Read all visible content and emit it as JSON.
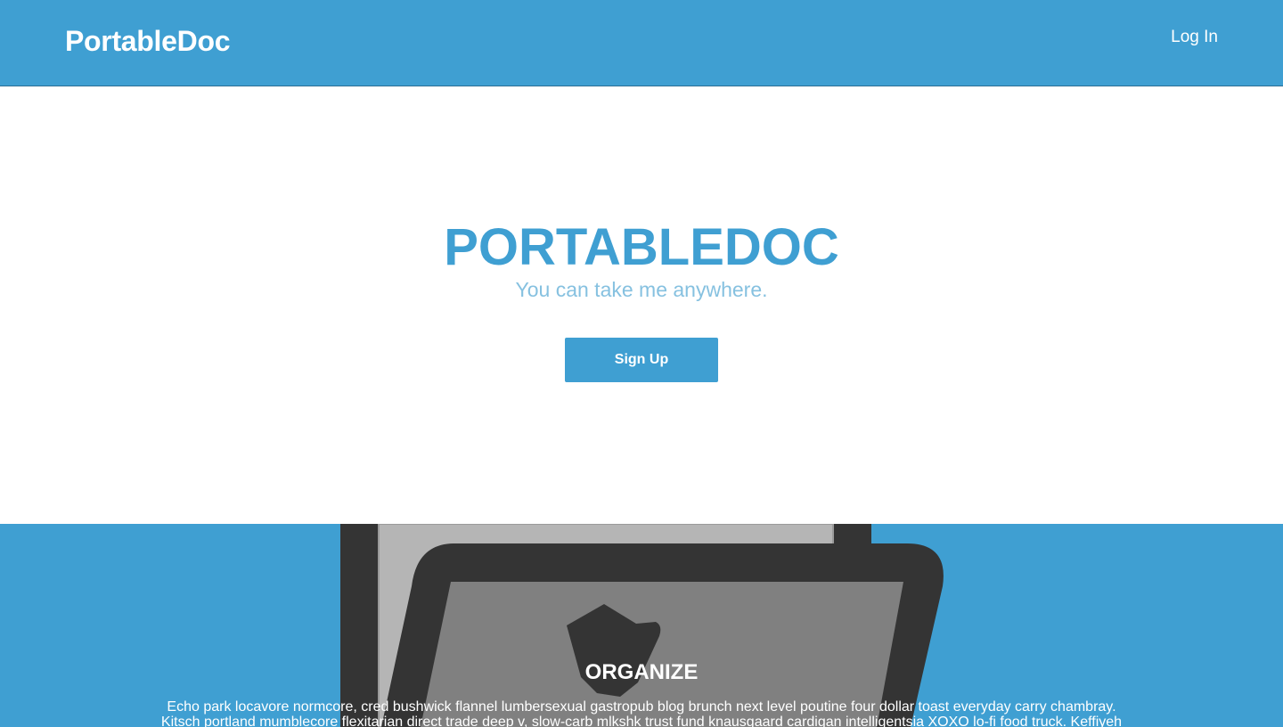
{
  "navbar": {
    "brand": "PortableDoc",
    "login_label": "Log In",
    "background_color": "#3f9fd2"
  },
  "hero": {
    "title": "PORTABLEDOC",
    "subtitle": "You can take me anywhere.",
    "signup_label": "Sign Up",
    "accent_color": "#3f9fd2"
  },
  "feature": {
    "title": "ORGANIZE",
    "body": "Echo park locavore normcore, cred bushwick flannel lumbersexual gastropub blog brunch next level poutine four dollar toast everyday carry chambray. Kitsch portland mumblecore flexitarian direct trade deep v, slow-carb mlkshk trust fund knausgaard cardigan intelligentsia XOXO lo-fi food truck. Keffiyeh",
    "illustration_icon": "document-tablet-illustration",
    "background_color": "#3f9fd2"
  }
}
